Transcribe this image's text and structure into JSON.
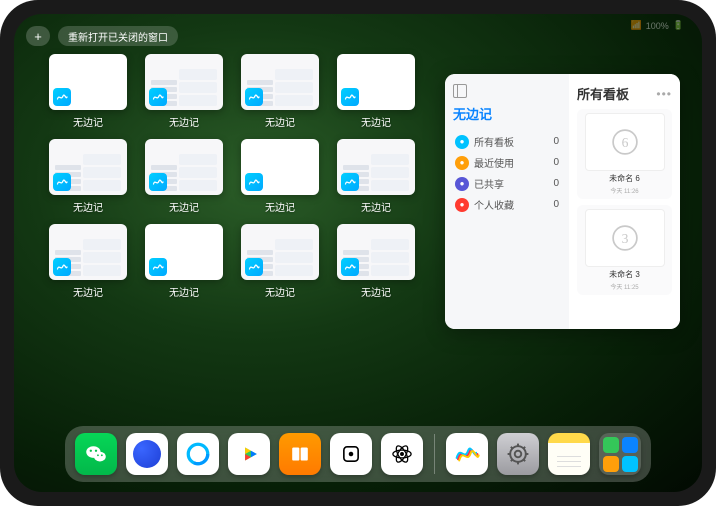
{
  "status": {
    "signal": "••••",
    "battery": "100%"
  },
  "topbar": {
    "plus": "+",
    "reopen_label": "重新打开已关闭的窗口"
  },
  "app_windows": [
    {
      "label": "无边记",
      "style": "blank"
    },
    {
      "label": "无边记",
      "style": "content"
    },
    {
      "label": "无边记",
      "style": "content"
    },
    {
      "label": "无边记",
      "style": "blank"
    },
    {
      "label": "无边记",
      "style": "content"
    },
    {
      "label": "无边记",
      "style": "content"
    },
    {
      "label": "无边记",
      "style": "blank"
    },
    {
      "label": "无边记",
      "style": "content"
    },
    {
      "label": "无边记",
      "style": "content"
    },
    {
      "label": "无边记",
      "style": "blank"
    },
    {
      "label": "无边记",
      "style": "content"
    },
    {
      "label": "无边记",
      "style": "content"
    }
  ],
  "panel": {
    "left_title": "无边记",
    "right_title": "所有看板",
    "more": "•••",
    "nav": [
      {
        "label": "所有看板",
        "count": "0",
        "color": "d-blue"
      },
      {
        "label": "最近使用",
        "count": "0",
        "color": "d-orange"
      },
      {
        "label": "已共享",
        "count": "0",
        "color": "d-indigo"
      },
      {
        "label": "个人收藏",
        "count": "0",
        "color": "d-red"
      }
    ],
    "boards": [
      {
        "title": "未命名 6",
        "sub": "今天 11:26",
        "glyph": "6"
      },
      {
        "title": "未命名 3",
        "sub": "今天 11:25",
        "glyph": "3"
      }
    ]
  },
  "dock": [
    {
      "name": "wechat"
    },
    {
      "name": "quark"
    },
    {
      "name": "qq-browser"
    },
    {
      "name": "play-video"
    },
    {
      "name": "books"
    },
    {
      "name": "dice"
    },
    {
      "name": "atom"
    },
    {
      "name": "separator"
    },
    {
      "name": "freeform"
    },
    {
      "name": "settings"
    },
    {
      "name": "notes"
    },
    {
      "name": "app-library"
    }
  ]
}
